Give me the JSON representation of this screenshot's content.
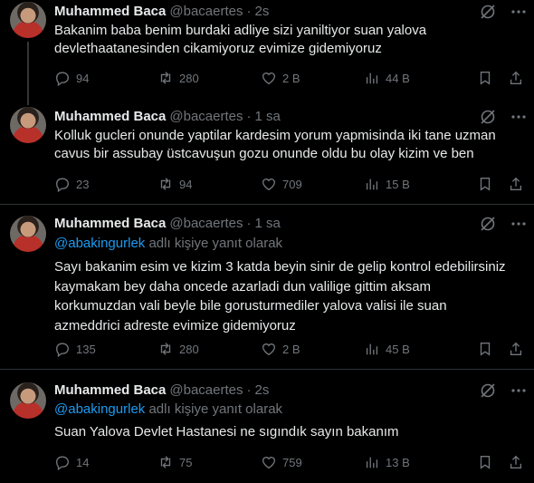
{
  "tweets": [
    {
      "name": "Muhammed Baca",
      "handle": "@bacaertes",
      "dot": "·",
      "time": "2s",
      "reply_prefix": "",
      "reply_mention": "",
      "reply_suffix": "",
      "text_lines": [
        "Bakanim baba benim burdaki adliye sizi yaniltiyor suan yalova",
        "devlethaatanesinden cikamiyoruz evimize gidemiyoruz"
      ],
      "replies": "94",
      "reposts": "280",
      "likes": "2 B",
      "views": "44 B"
    },
    {
      "name": "Muhammed Baca",
      "handle": "@bacaertes",
      "dot": "·",
      "time": "1 sa",
      "reply_prefix": "",
      "reply_mention": "",
      "reply_suffix": "",
      "text_lines": [
        "Kolluk gucleri onunde yaptilar kardesim yorum yapmisinda iki tane uzman",
        "cavus bir assubay üstcavuşun gozu onunde oldu bu olay kizim ve ben"
      ],
      "replies": "23",
      "reposts": "94",
      "likes": "709",
      "views": "15 B"
    },
    {
      "name": "Muhammed Baca",
      "handle": "@bacaertes",
      "dot": "·",
      "time": "1 sa",
      "reply_mention": "@abakingurlek",
      "reply_suffix": " adlı kişiye yanıt olarak",
      "text_lines": [
        "Sayı bakanim esim ve kizim 3 katda beyin sinir de gelip kontrol edebilirsiniz",
        "kaymakam bey daha oncede azarladi dun valilige gittim aksam",
        "korkumuzdan vali beyle bile gorusturmediler yalova valisi ile suan",
        "azmeddrici adreste evimize gidemiyoruz"
      ],
      "replies": "135",
      "reposts": "280",
      "likes": "2 B",
      "views": "45 B"
    },
    {
      "name": "Muhammed Baca",
      "handle": "@bacaertes",
      "dot": "·",
      "time": "2s",
      "reply_mention": "@abakingurlek",
      "reply_suffix": " adlı kişiye yanıt olarak",
      "text_lines": [
        "Suan Yalova Devlet Hastanesi ne sıgındık sayın bakanım"
      ],
      "replies": "14",
      "reposts": "75",
      "likes": "759",
      "views": "13 B"
    }
  ],
  "icons": {
    "mute": "mute-icon",
    "more": "more-icon",
    "reply": "reply-icon",
    "repost": "repost-icon",
    "like": "like-icon",
    "views": "views-icon",
    "bookmark": "bookmark-icon",
    "share": "share-icon"
  },
  "colors": {
    "background": "#000000",
    "text": "#e7e9ea",
    "secondary": "#71767b",
    "mention": "#1d9bf0",
    "divider": "#2f3336"
  }
}
